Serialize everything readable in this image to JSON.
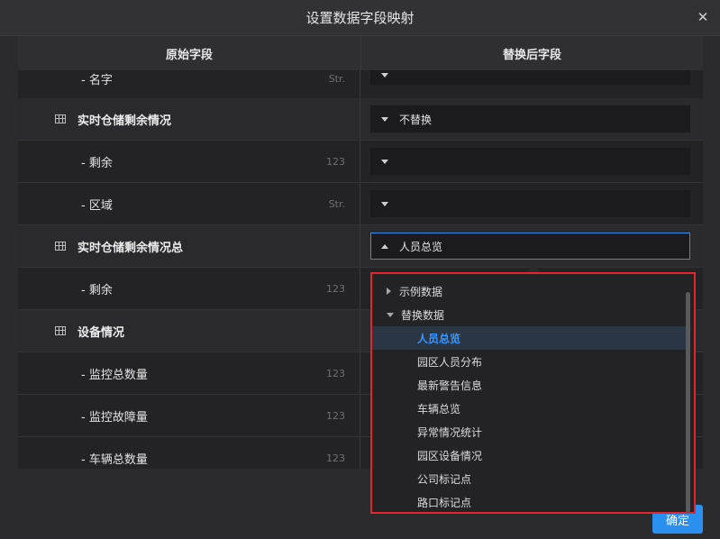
{
  "dialog": {
    "title": "设置数据字段映射",
    "confirm_label": "确定"
  },
  "table": {
    "col_original": "原始字段",
    "col_replaced": "替换后字段",
    "rows": [
      {
        "kind": "field",
        "name": "- 名字",
        "type": "Str.",
        "value": ""
      },
      {
        "kind": "group",
        "name": "实时仓储剩余情况",
        "value": "不替换"
      },
      {
        "kind": "field",
        "name": "- 剩余",
        "type": "123",
        "value": ""
      },
      {
        "kind": "field",
        "name": "- 区域",
        "type": "Str.",
        "value": ""
      },
      {
        "kind": "group",
        "name": "实时仓储剩余情况总",
        "value": "人员总览"
      },
      {
        "kind": "field",
        "name": "- 剩余",
        "type": "123"
      },
      {
        "kind": "group",
        "name": "设备情况"
      },
      {
        "kind": "field",
        "name": "- 监控总数量",
        "type": "123"
      },
      {
        "kind": "field",
        "name": "- 监控故障量",
        "type": "123"
      },
      {
        "kind": "field",
        "name": "- 车辆总数量",
        "type": "123"
      }
    ]
  },
  "dropdown": {
    "folders": {
      "sample": "示例数据",
      "replace": "替换数据"
    },
    "items": [
      "人员总览",
      "园区人员分布",
      "最新警告信息",
      "车辆总览",
      "异常情况统计",
      "园区设备情况",
      "公司标记点",
      "路口标记点"
    ],
    "selected": "人员总览"
  }
}
